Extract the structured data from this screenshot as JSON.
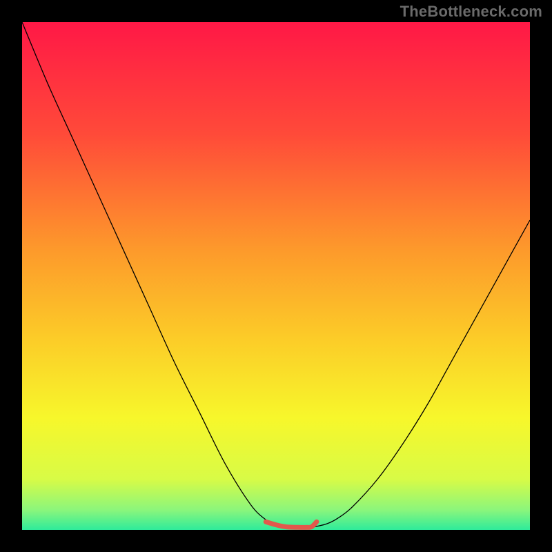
{
  "watermark": "TheBottleneck.com",
  "chart_data": {
    "type": "line",
    "title": "",
    "xlabel": "",
    "ylabel": "",
    "xlim": [
      0,
      100
    ],
    "ylim": [
      0,
      100
    ],
    "grid": false,
    "series": [
      {
        "name": "curve",
        "stroke": "#000000",
        "stroke_width": 1.3,
        "x": [
          0,
          5,
          10,
          15,
          20,
          25,
          30,
          35,
          40,
          45,
          48,
          50,
          52,
          55,
          56,
          57,
          58,
          60,
          62,
          65,
          70,
          75,
          80,
          85,
          90,
          95,
          100
        ],
        "values": [
          100,
          88,
          77,
          66,
          55,
          44,
          33,
          23,
          13,
          5,
          2,
          1,
          0.6,
          0.5,
          0.5,
          0.6,
          0.7,
          1.2,
          2.2,
          4.5,
          10,
          17,
          25,
          34,
          43,
          52,
          61
        ]
      },
      {
        "name": "optimal-marker",
        "stroke": "#E2574C",
        "stroke_width": 7,
        "linecap": "round",
        "x": [
          48,
          50,
          52,
          55,
          56,
          57,
          58
        ],
        "values": [
          1.6,
          1.0,
          0.6,
          0.5,
          0.5,
          0.6,
          1.6
        ]
      }
    ],
    "background_gradient": {
      "type": "linear",
      "angle_deg": 180,
      "stops": [
        {
          "offset": 0.0,
          "color": "#FF1846"
        },
        {
          "offset": 0.22,
          "color": "#FF4A39"
        },
        {
          "offset": 0.45,
          "color": "#FD9A2B"
        },
        {
          "offset": 0.62,
          "color": "#FCCB28"
        },
        {
          "offset": 0.78,
          "color": "#F7F72B"
        },
        {
          "offset": 0.9,
          "color": "#D8FB46"
        },
        {
          "offset": 0.96,
          "color": "#8CF67B"
        },
        {
          "offset": 1.0,
          "color": "#2EEB9B"
        }
      ]
    }
  }
}
